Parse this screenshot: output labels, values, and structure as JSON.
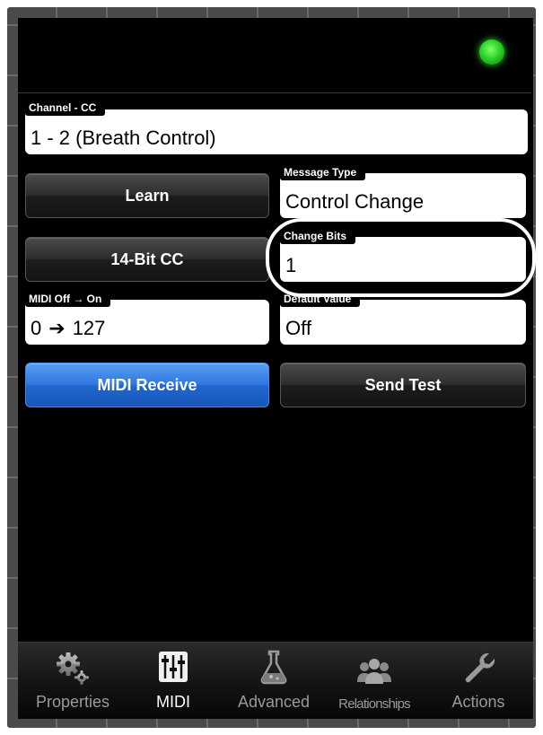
{
  "status": {
    "led_color": "#2fd42a"
  },
  "fields": {
    "channel_cc": {
      "label": "Channel - CC",
      "value": "1 - 2 (Breath Control)"
    },
    "message_type": {
      "label": "Message Type",
      "value": "Control Change"
    },
    "change_bits": {
      "label": "Change Bits",
      "value": "1"
    },
    "midi_off_on": {
      "label": "MIDI Off → On",
      "value_off": "0",
      "arrow": "➔",
      "value_on": "127"
    },
    "default_value": {
      "label": "Default Value",
      "value": "Off"
    }
  },
  "buttons": {
    "learn": "Learn",
    "fourteen_bit": "14-Bit CC",
    "midi_receive": "MIDI Receive",
    "send_test": "Send Test"
  },
  "tabs": [
    {
      "label": "Properties",
      "icon": "gears-icon",
      "active": false
    },
    {
      "label": "MIDI",
      "icon": "sliders-icon",
      "active": true
    },
    {
      "label": "Advanced",
      "icon": "flask-icon",
      "active": false
    },
    {
      "label": "Relationships",
      "icon": "people-icon",
      "active": false
    },
    {
      "label": "Actions",
      "icon": "wrench-icon",
      "active": false
    }
  ],
  "colors": {
    "accent_blue": "#2f79e0",
    "highlight_ring": "#ffffff"
  }
}
